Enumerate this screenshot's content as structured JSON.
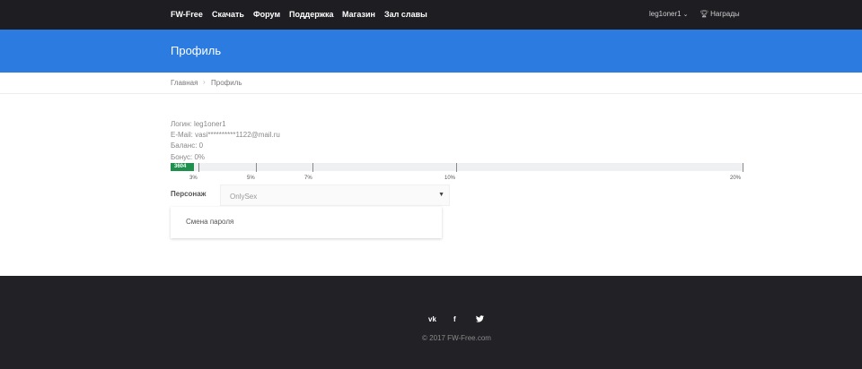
{
  "header": {
    "brand": "FW-Free",
    "nav": [
      "Скачать",
      "Форум",
      "Поддержка",
      "Магазин",
      "Зал славы"
    ],
    "username": "leg1oner1",
    "awards_label": "Награды"
  },
  "banner": {
    "title": "Профиль"
  },
  "breadcrumb": {
    "home": "Главная",
    "current": "Профиль"
  },
  "profile": {
    "login": "Логин: leg1oner1",
    "email": "E-Mail: vasi**********1122@mail.ru",
    "balance": "Баланс: 0",
    "bonus": "Бонус: 0%"
  },
  "progress": {
    "value_label": "3604",
    "fill_fraction": 0.04,
    "fill_color": "#1f8f4e",
    "ticks": [
      "3%",
      "5%",
      "7%",
      "10%",
      "20%"
    ]
  },
  "character": {
    "label": "Персонаж",
    "selected": "OnlySex"
  },
  "password_card": {
    "label": "Смена пароля"
  },
  "footer": {
    "social": [
      "vk-icon",
      "facebook-icon",
      "twitter-icon"
    ],
    "copyright": "© 2017 FW-Free.com"
  },
  "colors": {
    "accent": "#2b7be0",
    "topbar": "#1e1e22",
    "footer": "#222226"
  }
}
